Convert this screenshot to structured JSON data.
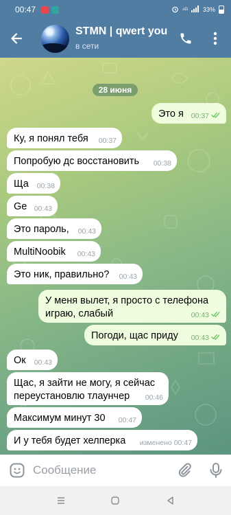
{
  "status_bar": {
    "time": "00:47",
    "indicators": "⁴ᴳ",
    "battery": "33%",
    "app_icons": [
      "notification-app-icon",
      "chat-app-icon"
    ],
    "app_icon_colors": [
      "#e5484d",
      "#31a6a0"
    ]
  },
  "header": {
    "title": "STMN | qwert you",
    "status": "в сети",
    "icons": [
      "back-arrow-icon",
      "phone-icon",
      "more-vertical-icon"
    ]
  },
  "chat": {
    "date_label": "28 июня",
    "messages": [
      {
        "direction": "out",
        "text": "Это я",
        "time": "00:37",
        "read": true
      },
      {
        "direction": "in",
        "text": "Ку, я понял тебя",
        "time": "00:37"
      },
      {
        "direction": "in",
        "text": "Попробую дс восстановить",
        "time": "00:38"
      },
      {
        "direction": "in",
        "text": "Ща",
        "time": "00:38"
      },
      {
        "direction": "in",
        "text": "Ge",
        "time": "00:43"
      },
      {
        "direction": "in",
        "text": "Это пароль,",
        "time": "00:43"
      },
      {
        "direction": "in",
        "text": "MultiNoobik",
        "time": "00:43"
      },
      {
        "direction": "in",
        "text": "Это ник, правильно?",
        "time": "00:43"
      },
      {
        "direction": "out",
        "text": "У меня вылет, я просто с телефона играю, слабый",
        "lines": [
          "У меня вылет, я просто с телефона",
          "играю, слабый"
        ],
        "time": "00:43",
        "read": true
      },
      {
        "direction": "out",
        "text": "Погоди, щас приду",
        "time": "00:43",
        "read": true
      },
      {
        "direction": "in",
        "text": "Ок",
        "time": "00:43"
      },
      {
        "direction": "in",
        "text": "Щас, я зайти не могу, я сейчас переустановлю тлаунчер",
        "lines": [
          "Щас, я зайти не могу, я сейчас",
          "переустановлю тлаунчер"
        ],
        "time": "00:46"
      },
      {
        "direction": "in",
        "text": "Максимум минут 30",
        "time": "00:47"
      },
      {
        "direction": "in",
        "text": "И у тебя будет хелперка",
        "time": "00:47",
        "edited": "изменено"
      }
    ]
  },
  "composer": {
    "placeholder": "Сообщение",
    "icons": [
      "emoji-icon",
      "attach-icon",
      "microphone-icon"
    ]
  },
  "colors": {
    "header": "#527da3",
    "incoming_bubble": "#ffffff",
    "outgoing_bubble": "#effdde",
    "read_check": "#5fbf5a"
  }
}
